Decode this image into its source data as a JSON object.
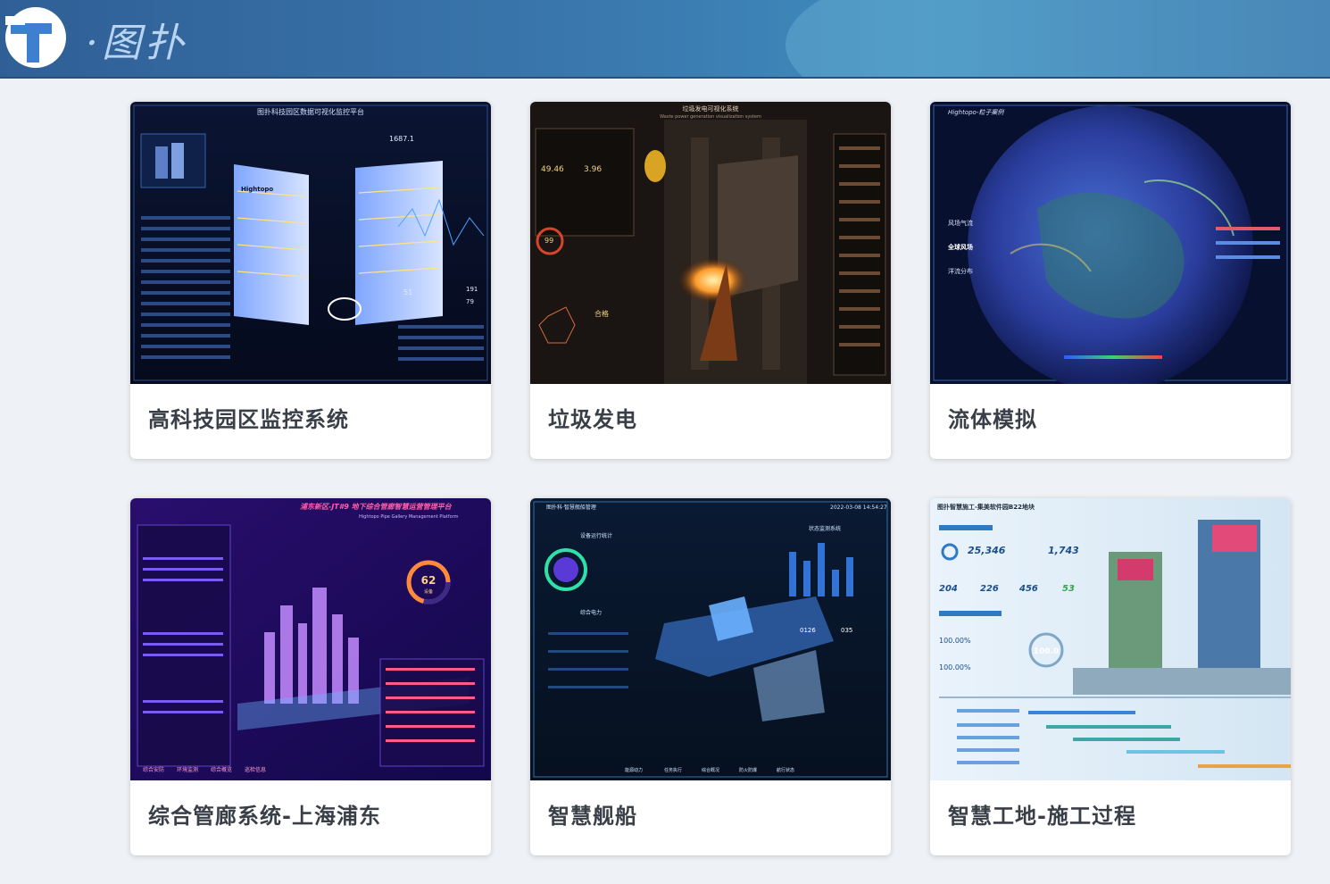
{
  "header": {
    "logo_icon": "letter-t-logo-icon",
    "brand_text": "·图扑"
  },
  "colors": {
    "header_bg": "#3a78ad",
    "page_bg": "#eef1f5",
    "card_bg": "#ffffff",
    "title_text": "#3a3f47"
  },
  "cards": [
    {
      "title": "高科技园区监控系统",
      "thumb": {
        "heading": "图扑科技园区数据可视化监控平台",
        "brand": "Hightopo",
        "value_main": "1687.1",
        "value_a": "51",
        "value_b": "191",
        "value_c": "79"
      }
    },
    {
      "title": "垃圾发电",
      "thumb": {
        "heading": "垃圾发电可视化系统",
        "subheading": "Waste power generation visualization system",
        "value_a": "49.46",
        "value_b": "3.96",
        "value_c": "99",
        "status": "合格"
      }
    },
    {
      "title": "流体模拟",
      "thumb": {
        "heading": "Hightopo-粒子案例",
        "label_a": "风场气流",
        "label_b": "全球风场",
        "label_c": "洋流分布"
      }
    },
    {
      "title": "综合管廊系统-上海浦东",
      "thumb": {
        "heading": "浦东新区-JT#9 地下综合管廊智慧运营管理平台",
        "subheading": "Hightopo Pipe Gallery Management Platform",
        "gauge_value": "62",
        "gauge_label": "设备",
        "tabs": [
          "综合安防",
          "环境监测",
          "综合概览",
          "巡检信息"
        ]
      }
    },
    {
      "title": "智慧舰船",
      "thumb": {
        "heading": "图扑科·智慧舰船管理",
        "timestamp": "2022-03-08 14:54:27",
        "panel_a": "设备运行统计",
        "panel_b": "状态监测系统",
        "panel_c": "综合电力",
        "value_a": "0126",
        "value_b": "035",
        "tabs": [
          "能源动力",
          "任务执行",
          "综合概况",
          "防火防爆",
          "航行状态"
        ]
      }
    },
    {
      "title": "智慧工地-施工过程",
      "thumb": {
        "heading": "图扑智慧施工-集美软件园B22地块",
        "stat_a": "25,346",
        "stat_b": "1,743",
        "num_a": "204",
        "num_b": "226",
        "num_c": "456",
        "num_d": "53",
        "pct_a": "100.00%",
        "pct_b": "100.00%",
        "center_value": "100.0"
      }
    }
  ]
}
